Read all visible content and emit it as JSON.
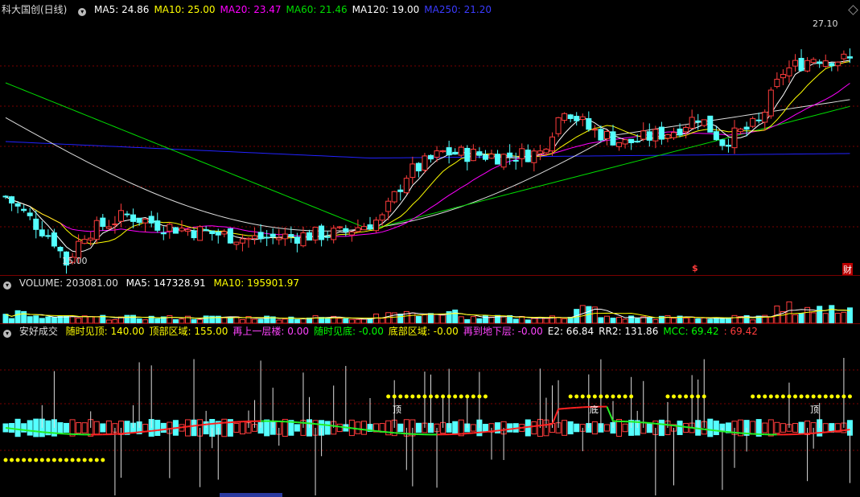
{
  "colors": {
    "up": "#ff3c3c",
    "down": "#54ffff",
    "ma5": "#ffffff",
    "ma10": "#ffff00",
    "ma20": "#ff00ff",
    "ma60": "#00dd00",
    "ma120": "#dddddd",
    "ma250": "#2222ff",
    "grid": "#7a0000"
  },
  "main": {
    "title": "科大国创(日线)",
    "collapse_icon": "chevron-down-icon",
    "ma_labels": [
      {
        "text": "MA5: 24.86",
        "color": "#ffffff"
      },
      {
        "text": "MA10: 25.00",
        "color": "#ffff00"
      },
      {
        "text": "MA20: 23.47",
        "color": "#ff00ff"
      },
      {
        "text": "MA60: 21.46",
        "color": "#00dd00"
      },
      {
        "text": "MA120: 19.00",
        "color": "#ffffff"
      },
      {
        "text": "MA250: 21.20",
        "color": "#3b3bff"
      }
    ],
    "high_label": "27.10",
    "low_label": "15.00",
    "marker_s": "$",
    "marker_cai": "财"
  },
  "volume": {
    "label": "VOLUME: 203081.00",
    "ma5": "MA5: 147328.91",
    "ma10": "MA10: 195901.97"
  },
  "indicator": {
    "name": "安好成交",
    "items": [
      {
        "text": "随时见顶: 140.00",
        "color": "#ffff00"
      },
      {
        "text": "顶部区域: 155.00",
        "color": "#ffff00"
      },
      {
        "text": "再上一层楼: 0.00",
        "color": "#ff44ff"
      },
      {
        "text": "随时见底: -0.00",
        "color": "#00ff00"
      },
      {
        "text": "底部区域: -0.00",
        "color": "#ffff00"
      },
      {
        "text": "再到地下层: -0.00",
        "color": "#ff44ff"
      },
      {
        "text": "E2: 66.84",
        "color": "#ffffff"
      },
      {
        "text": "RR2: 131.86",
        "color": "#ffffff"
      },
      {
        "text": "MCC: 69.42",
        "color": "#00ff00"
      },
      {
        "text": ": 69.42",
        "color": "#ff3c3c"
      }
    ],
    "label_ding": "顶",
    "label_di": "底"
  }
}
